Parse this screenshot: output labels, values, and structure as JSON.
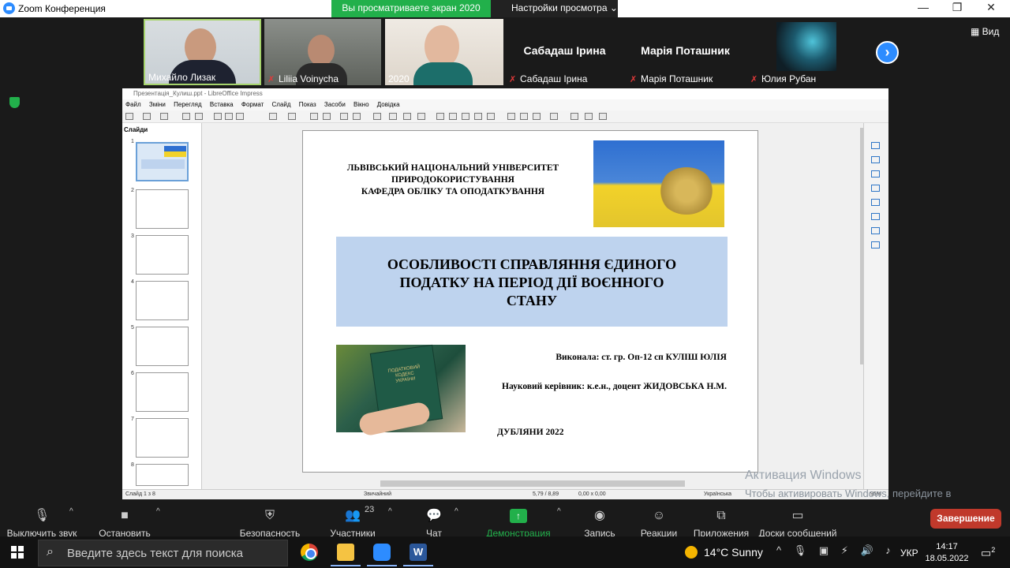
{
  "window": {
    "title": "Zoom Конференция",
    "minimize": "—",
    "restore": "❐",
    "close": "✕"
  },
  "share_banner": {
    "viewing": "Вы просматриваете экран 2020",
    "view_options": "Настройки просмотра"
  },
  "participants": [
    {
      "name": "Михайло Лизак",
      "muted": false
    },
    {
      "name": "Liliia Voinycha",
      "muted": true
    },
    {
      "name": "2020",
      "muted": false
    },
    {
      "name": "Сабадаш Ірина",
      "muted": true,
      "big": "Сабадаш Ірина"
    },
    {
      "name": "Марія Поташник",
      "muted": true,
      "big": "Марія Поташник"
    },
    {
      "name": "Юлия Рубан",
      "muted": true
    }
  ],
  "view_button": "Вид",
  "impress": {
    "title": "Презентація_Кулиш.ppt - LibreOffice Impress",
    "menu": [
      "Файл",
      "Зміни",
      "Перегляд",
      "Вставка",
      "Формат",
      "Слайд",
      "Показ",
      "Засоби",
      "Вікно",
      "Довідка"
    ],
    "slides_header": "Слайди",
    "thumb_numbers": [
      "1",
      "2",
      "3",
      "4",
      "5",
      "6",
      "7",
      "8"
    ],
    "status": {
      "slide": "Слайд 1 з 8",
      "layout": "Звичайний",
      "pos": "5,79 / 8,89",
      "size": "0,00 x 0,00",
      "lang": "Українська",
      "zoom": "95%"
    }
  },
  "slide": {
    "university": [
      "ЛЬВІВСЬКИЙ НАЦІОНАЛЬНИЙ УНІВЕРСИТЕТ",
      "ПРИРОДОКОРИСТУВАННЯ",
      "КАФЕДРА ОБЛІКУ ТА ОПОДАТКУВАННЯ"
    ],
    "title": [
      "ОСОБЛИВОСТІ СПРАВЛЯННЯ ЄДИНОГО",
      "ПОДАТКУ НА ПЕРІОД ДІЇ ВОЄННОГО",
      "СТАНУ"
    ],
    "author": "Виконала: ст. гр. Оп-12 сп  КУЛІШ ЮЛІЯ",
    "supervisor": "Науковий керівник: к.е.н., доцент  ЖИДОВСЬКА Н.М.",
    "city": "ДУБЛЯНИ 2022",
    "book": [
      "ПОДАТКОВИЙ",
      "КОДЕКС",
      "УКРАЇНИ"
    ]
  },
  "activation": {
    "title": "Активация Windows",
    "text": "Чтобы активировать Windows, перейдите в раздел \"Параметры\"."
  },
  "toolbar": {
    "mute": "Выключить звук",
    "video": "Остановить видео",
    "security": "Безопасность",
    "participants": "Участники",
    "participants_count": "23",
    "chat": "Чат",
    "share": "Демонстрация экрана",
    "record": "Запись",
    "reactions": "Реакции",
    "apps": "Приложения",
    "whiteboards": "Доски сообщений",
    "end": "Завершение"
  },
  "taskbar": {
    "search_placeholder": "Введите здесь текст для поиска",
    "weather": "14°C  Sunny",
    "lang": "УКР",
    "time": "14:17",
    "date": "18.05.2022",
    "notif_count": "2"
  }
}
